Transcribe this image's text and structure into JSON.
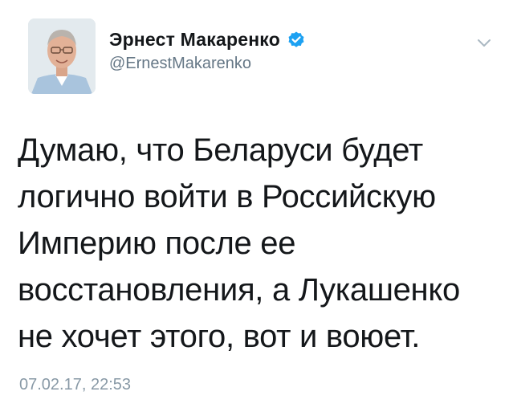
{
  "tweet": {
    "author_name": "Эрнест Макаренко",
    "handle": "@ErnestMakarenko",
    "text": "Думаю, что Беларуси будет логично войти в Российскую Империю после ее восстановления, а Лукашенко не хочет этого, вот и воюет.",
    "timestamp": "07.02.17, 22:53",
    "verified": true,
    "icons": {
      "verified": "verified-badge-icon",
      "menu": "chevron-down-icon"
    },
    "colors": {
      "text": "#14171a",
      "secondary": "#657786",
      "timestamp": "#8899a6",
      "verified_badge": "#1da1f2"
    }
  }
}
